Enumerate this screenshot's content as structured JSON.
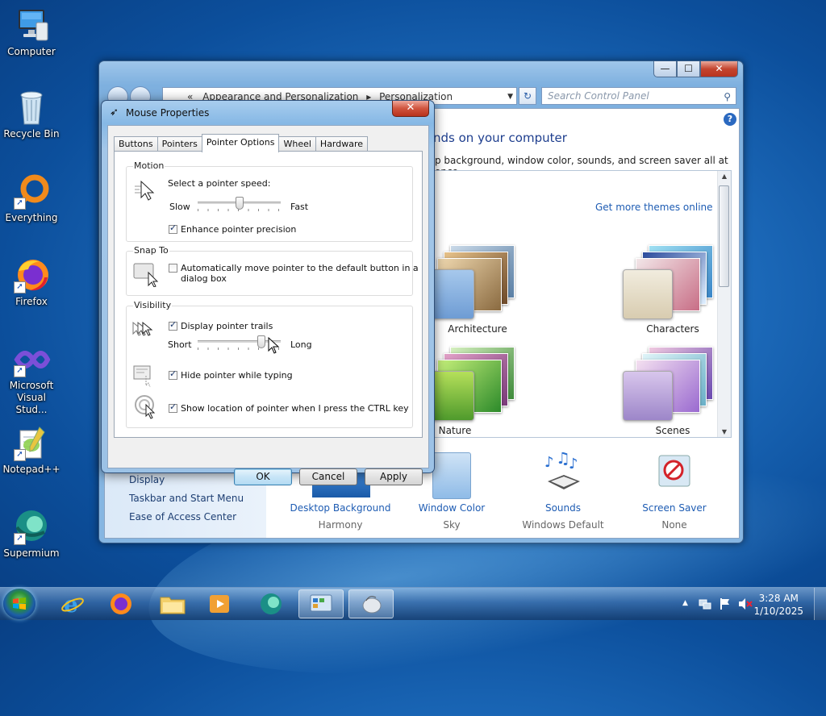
{
  "desktop": {
    "icons": [
      {
        "label": "Computer",
        "icon": "computer-icon"
      },
      {
        "label": "Recycle Bin",
        "icon": "recycle-bin-icon"
      },
      {
        "label": "Everything",
        "icon": "everything-icon"
      },
      {
        "label": "Firefox",
        "icon": "firefox-icon"
      },
      {
        "label": "Microsoft Visual Stud...",
        "icon": "visual-studio-icon"
      },
      {
        "label": "Notepad++",
        "icon": "notepadpp-icon"
      },
      {
        "label": "Supermium",
        "icon": "supermium-icon"
      }
    ]
  },
  "control_panel": {
    "address": {
      "root": "«",
      "crumb1": "Appearance and Personalization",
      "sep": "▸",
      "crumb2": "Personalization"
    },
    "search_placeholder": "Search Control Panel",
    "heading": "nds on your computer",
    "subtitle": "p background, window color, sounds, and screen saver all at once.",
    "get_more": "Get more themes online",
    "themes": [
      {
        "name": "Architecture"
      },
      {
        "name": "Characters"
      },
      {
        "name": "Nature"
      },
      {
        "name": "Scenes"
      }
    ],
    "left_links": [
      "Display",
      "Taskbar and Start Menu",
      "Ease of Access Center"
    ],
    "bottom": [
      {
        "name": "Desktop Background",
        "value": "Harmony"
      },
      {
        "name": "Window Color",
        "value": "Sky"
      },
      {
        "name": "Sounds",
        "value": "Windows Default"
      },
      {
        "name": "Screen Saver",
        "value": "None"
      }
    ],
    "caption": {
      "min": "—",
      "max": "☐",
      "close": "✕"
    }
  },
  "mouse_dialog": {
    "title": "Mouse Properties",
    "close": "✕",
    "tabs": [
      "Buttons",
      "Pointers",
      "Pointer Options",
      "Wheel",
      "Hardware"
    ],
    "active_tab": "Pointer Options",
    "motion": {
      "group": "Motion",
      "prompt": "Select a pointer speed:",
      "slow": "Slow",
      "fast": "Fast",
      "speed_fraction": 0.5,
      "precision_label": "Enhance pointer precision",
      "precision_checked": true
    },
    "snap": {
      "group": "Snap To",
      "label_line1": "Automatically move pointer to the default button in a",
      "label_line2": "dialog box",
      "checked": false
    },
    "visibility": {
      "group": "Visibility",
      "trails_label": "Display pointer trails",
      "trails_checked": true,
      "short": "Short",
      "long": "Long",
      "trail_fraction": 0.77,
      "hide_label": "Hide pointer while typing",
      "hide_checked": true,
      "ctrl_label": "Show location of pointer when I press the CTRL key",
      "ctrl_checked": true
    },
    "buttons": {
      "ok": "OK",
      "cancel": "Cancel",
      "apply": "Apply"
    }
  },
  "taskbar": {
    "time": "3:28 AM",
    "date": "1/10/2025",
    "tray_arrow": "▲"
  }
}
